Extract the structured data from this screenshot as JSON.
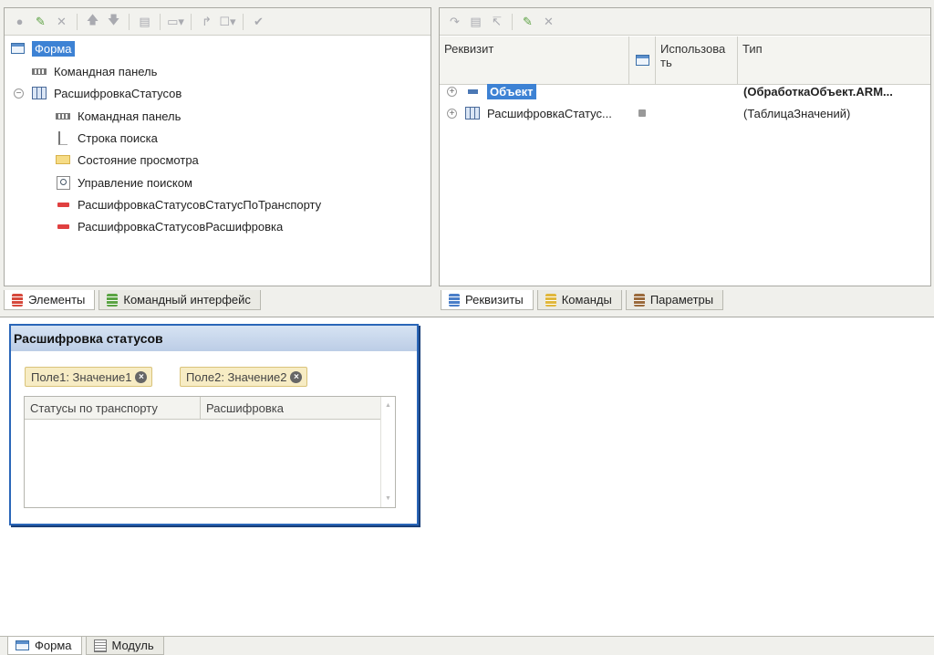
{
  "elements_tree": [
    {
      "label": "Форма",
      "icon": "form-icon",
      "selected": true
    },
    {
      "label": "Командная панель",
      "icon": "command-bar-icon"
    },
    {
      "label": "РасшифровкаСтатусов",
      "icon": "table-icon",
      "expanded": true
    },
    {
      "label": "Командная панель",
      "icon": "command-bar-icon"
    },
    {
      "label": "Строка поиска",
      "icon": "search-string-icon"
    },
    {
      "label": "Состояние просмотра",
      "icon": "view-state-icon"
    },
    {
      "label": "Управление поиском",
      "icon": "search-control-icon"
    },
    {
      "label": "РасшифровкаСтатусовСтатусПоТранспорту",
      "icon": "field-icon"
    },
    {
      "label": "РасшифровкаСтатусовРасшифровка",
      "icon": "field-icon"
    }
  ],
  "left_tabs": [
    "Элементы",
    "Командный интерфейс"
  ],
  "attributes": {
    "columns": [
      "Реквизит",
      "Использова ть",
      "Тип"
    ],
    "rows": [
      {
        "name": "Объект",
        "type": "(ОбработкаОбъект.ARM..."
      },
      {
        "name": "РасшифровкаСтатус...",
        "type": "(ТаблицаЗначений)"
      }
    ]
  },
  "right_tabs": [
    "Реквизиты",
    "Команды",
    "Параметры"
  ],
  "preview": {
    "title": "Расшифровка статусов",
    "chips": [
      "Поле1: Значение1",
      "Поле2: Значение2"
    ],
    "columns": [
      "Статусы по транспорту",
      "Расшифровка"
    ]
  },
  "bottom_tabs": [
    "Форма",
    "Модуль"
  ]
}
